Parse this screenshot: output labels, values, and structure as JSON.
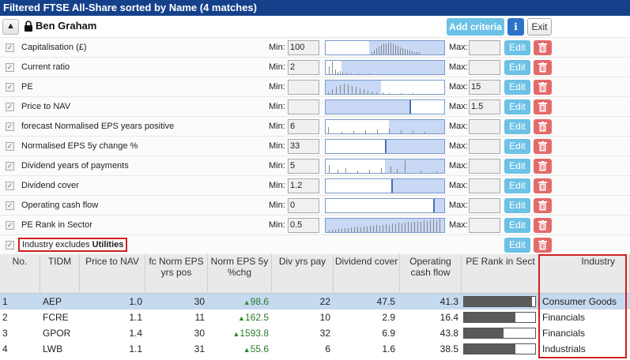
{
  "title": "Filtered FTSE All-Share sorted by Name (4 matches)",
  "header": {
    "screen_name": "Ben Graham",
    "add_criteria_label": "Add criteria",
    "info_label": "i",
    "exit_label": "Exit"
  },
  "labels": {
    "min": "Min:",
    "max": "Max:",
    "edit": "Edit"
  },
  "criteria": [
    {
      "label": "Capitalisation (£)",
      "min": "100",
      "max": ""
    },
    {
      "label": "Current ratio",
      "min": "2",
      "max": ""
    },
    {
      "label": "PE",
      "min": "",
      "max": "15"
    },
    {
      "label": "Price to NAV",
      "min": "",
      "max": "1.5"
    },
    {
      "label": "forecast Normalised EPS years positive",
      "min": "6",
      "max": ""
    },
    {
      "label": "Normalised EPS 5y change %",
      "min": "33",
      "max": ""
    },
    {
      "label": "Dividend years of payments",
      "min": "5",
      "max": ""
    },
    {
      "label": "Dividend cover",
      "min": "1.2",
      "max": ""
    },
    {
      "label": "Operating cash flow",
      "min": "0",
      "max": ""
    },
    {
      "label": "PE Rank in Sector",
      "min": "0.5",
      "max": ""
    }
  ],
  "industry_filter": {
    "prefix": "Industry excludes ",
    "value": "Utilities"
  },
  "results": {
    "columns": [
      "No.",
      "TIDM",
      "Price to NAV",
      "fc Norm EPS yrs pos",
      "Norm EPS 5y %chg",
      "Div yrs pay",
      "Dividend cover",
      "Operating cash flow",
      "PE Rank in Sect",
      "Industry"
    ],
    "rows": [
      {
        "no": "1",
        "tidm": "AEP",
        "ptnav": "1.0",
        "fceps": "30",
        "epschg": "98.6",
        "divyrs": "22",
        "divcov": "47.5",
        "ocf": "41.3",
        "rank": 0.95,
        "industry": "Consumer Goods"
      },
      {
        "no": "2",
        "tidm": "FCRE",
        "ptnav": "1.1",
        "fceps": "11",
        "epschg": "162.5",
        "divyrs": "10",
        "divcov": "2.9",
        "ocf": "16.4",
        "rank": 0.72,
        "industry": "Financials"
      },
      {
        "no": "3",
        "tidm": "GPOR",
        "ptnav": "1.4",
        "fceps": "30",
        "epschg": "1593.8",
        "divyrs": "32",
        "divcov": "6.9",
        "ocf": "43.8",
        "rank": 0.55,
        "industry": "Financials"
      },
      {
        "no": "4",
        "tidm": "LWB",
        "ptnav": "1.1",
        "fceps": "31",
        "epschg": "55.6",
        "divyrs": "6",
        "divcov": "1.6",
        "ocf": "38.5",
        "rank": 0.72,
        "industry": "Industrials"
      }
    ]
  },
  "colors": {
    "title_bar": "#15418a",
    "edit": "#6cc1e6",
    "delete": "#e46a6a",
    "selected_row": "#c5d9ef",
    "gain": "#2a8a2a",
    "highlight_box": "#d21f1f"
  }
}
